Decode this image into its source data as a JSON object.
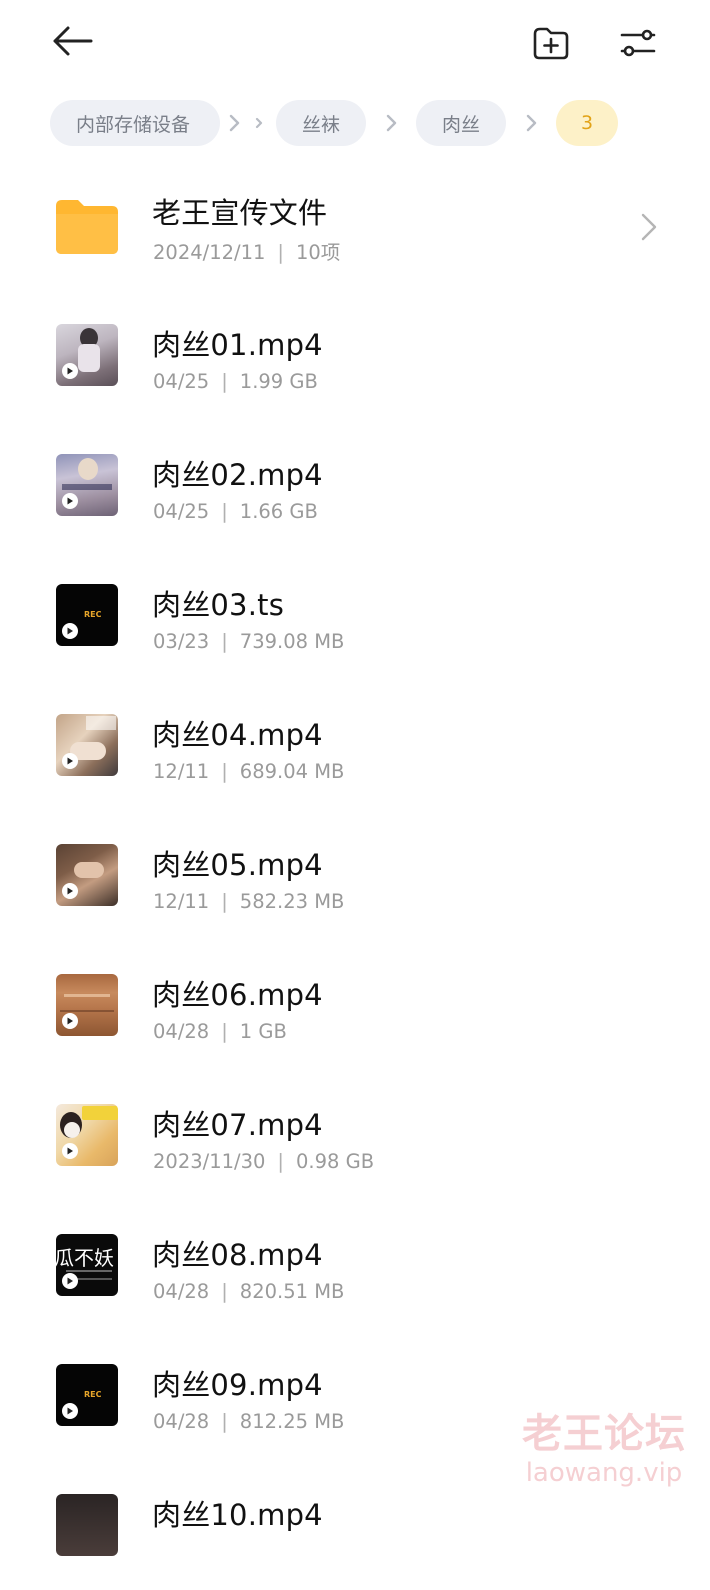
{
  "header": {
    "back_icon": "arrow-left-icon",
    "new_folder_icon": "folder-plus-icon",
    "filter_icon": "sliders-icon"
  },
  "breadcrumb": {
    "items": [
      {
        "label": "内部存储设备"
      },
      {
        "label": "丝袜"
      },
      {
        "label": "肉丝"
      },
      {
        "label": "3"
      }
    ],
    "active_color": "#e2a317"
  },
  "folder": {
    "name": "老王宣传文件",
    "date": "2024/12/11",
    "count": "10项",
    "color": "#ffb731"
  },
  "files": [
    {
      "name": "肉丝01.mp4",
      "date": "04/25",
      "size": "1.99 GB",
      "thumb": "photo"
    },
    {
      "name": "肉丝02.mp4",
      "date": "04/25",
      "size": "1.66 GB",
      "thumb": "photo"
    },
    {
      "name": "肉丝03.ts",
      "date": "03/23",
      "size": "739.08 MB",
      "thumb": "rec",
      "thumb_text": "REC"
    },
    {
      "name": "肉丝04.mp4",
      "date": "12/11",
      "size": "689.04 MB",
      "thumb": "photo"
    },
    {
      "name": "肉丝05.mp4",
      "date": "12/11",
      "size": "582.23 MB",
      "thumb": "photo"
    },
    {
      "name": "肉丝06.mp4",
      "date": "04/28",
      "size": "1 GB",
      "thumb": "photo"
    },
    {
      "name": "肉丝07.mp4",
      "date": "2023/11/30",
      "size": "0.98 GB",
      "thumb": "photo"
    },
    {
      "name": "肉丝08.mp4",
      "date": "04/28",
      "size": "820.51 MB",
      "thumb": "text",
      "thumb_text": "瓜不妖"
    },
    {
      "name": "肉丝09.mp4",
      "date": "04/28",
      "size": "812.25 MB",
      "thumb": "rec",
      "thumb_text": "REC"
    },
    {
      "name": "肉丝10.mp4",
      "date": "",
      "size": "",
      "thumb": "photo"
    }
  ],
  "watermark": {
    "cn": "老王论坛",
    "en": "laowang.vip"
  }
}
